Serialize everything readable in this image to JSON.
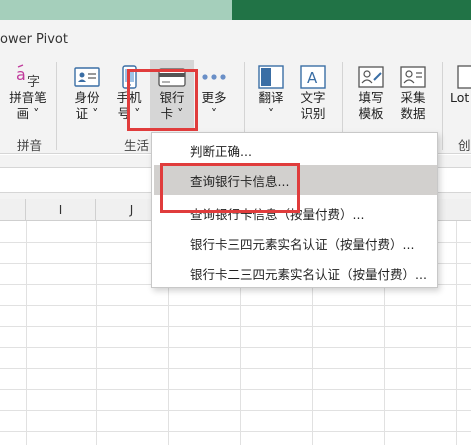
{
  "ribbon": {
    "tab_label": "ower Pivot",
    "buttons": {
      "pinyin": {
        "line1": "拼音笔",
        "line2": "画 ˅"
      },
      "id": {
        "line1": "身份",
        "line2": "证 ˅"
      },
      "phone": {
        "line1": "手机",
        "line2": "号 ˅"
      },
      "bank": {
        "line1": "银行",
        "line2": "卡 ˅"
      },
      "more": {
        "line1": "更多",
        "line2": "˅"
      },
      "translate": {
        "line1": "翻译",
        "line2": "˅"
      },
      "ocr": {
        "line1": "文字",
        "line2": "识别"
      },
      "fill_template": {
        "line1": "填写",
        "line2": "模板"
      },
      "collect_data": {
        "line1": "采集",
        "line2": "数据"
      },
      "lot": {
        "line1": "Lot"
      }
    },
    "groups": {
      "pinyin": "拼音",
      "life": "生活",
      "partial_right": "创"
    }
  },
  "columns": [
    "I",
    "J"
  ],
  "bank_menu": {
    "items": [
      "判断正确...",
      "查询银行卡信息...",
      "查询银行卡信息（按量付费）...",
      "银行卡三四元素实名认证（按量付费）...",
      "银行卡二三四元素实名认证（按量付费）..."
    ],
    "hovered_index": 1
  },
  "colors": {
    "excel_green": "#217346",
    "highlight_red": "#e03c3c",
    "menu_hover": "#d2d0ce"
  }
}
